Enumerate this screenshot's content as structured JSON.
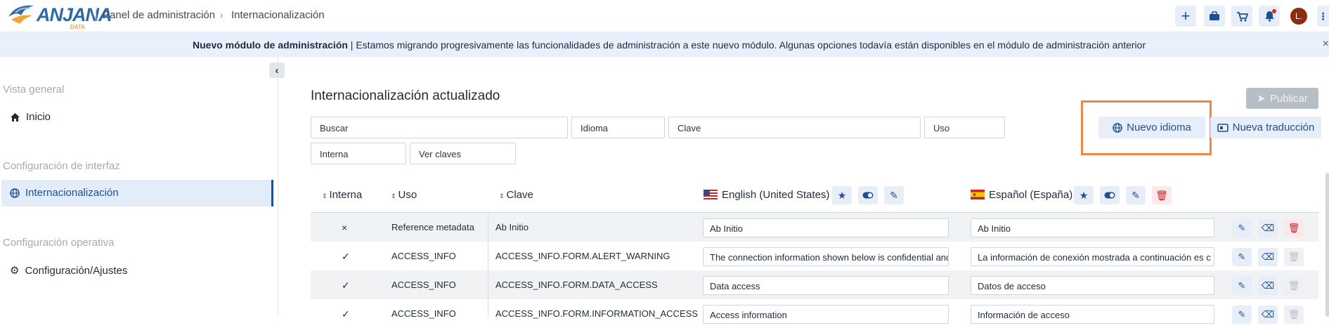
{
  "header": {
    "logo_text": "ANJANA",
    "logo_sub": "DATA",
    "breadcrumb": [
      "Panel de administración",
      "Internacionalización"
    ],
    "avatar_initial": "L.",
    "icons": [
      "plus-icon",
      "briefcase-icon",
      "cart-icon",
      "bell-icon",
      "kebab-icon"
    ]
  },
  "banner": {
    "bold": "Nuevo módulo de administración",
    "text": " | Estamos migrando progresivamente las funcionalidades de administración a este nuevo módulo. Algunas opciones todavía están disponibles en el  módulo de administración anterior",
    "close": "×"
  },
  "sidebar": {
    "sections": [
      {
        "title": "Vista general",
        "items": [
          {
            "label": "Inicio",
            "icon": "home-icon"
          }
        ]
      },
      {
        "title": "Configuración de interfaz",
        "items": [
          {
            "label": "Internacionalización",
            "icon": "globe-icon",
            "active": true
          }
        ]
      },
      {
        "title": "Configuración operativa",
        "items": [
          {
            "label": "Configuración/Ajustes",
            "icon": "gear-icon"
          }
        ]
      }
    ]
  },
  "main": {
    "title": "Internacionalización actualizado",
    "publish_label": "Publicar",
    "new_language_label": "Nuevo idioma",
    "new_translation_label": "Nueva traducción",
    "filters": {
      "buscar": "Buscar",
      "idioma": "Idioma",
      "clave": "Clave",
      "uso": "Uso",
      "interna": "Interna",
      "ver_claves": "Ver claves"
    },
    "columns": {
      "interna": "Interna",
      "uso": "Uso",
      "clave": "Clave",
      "lang1": "English (United States)",
      "lang2": "Español (España)"
    },
    "rows": [
      {
        "interna": "×",
        "uso": "Reference metadata",
        "clave": "Ab Initio",
        "en": "Ab Initio",
        "es": "Ab Initio"
      },
      {
        "interna": "✓",
        "uso": "ACCESS_INFO",
        "clave": "ACCESS_INFO.FORM.ALERT_WARNING",
        "en": "The connection information shown below is confidential and",
        "es": "La información de conexión mostrada a continuación es c"
      },
      {
        "interna": "✓",
        "uso": "ACCESS_INFO",
        "clave": "ACCESS_INFO.FORM.DATA_ACCESS",
        "en": "Data access",
        "es": "Datos de acceso"
      },
      {
        "interna": "✓",
        "uso": "ACCESS_INFO",
        "clave": "ACCESS_INFO.FORM.INFORMATION_ACCESS",
        "en": "Access information",
        "es": "Información de acceso"
      }
    ]
  }
}
